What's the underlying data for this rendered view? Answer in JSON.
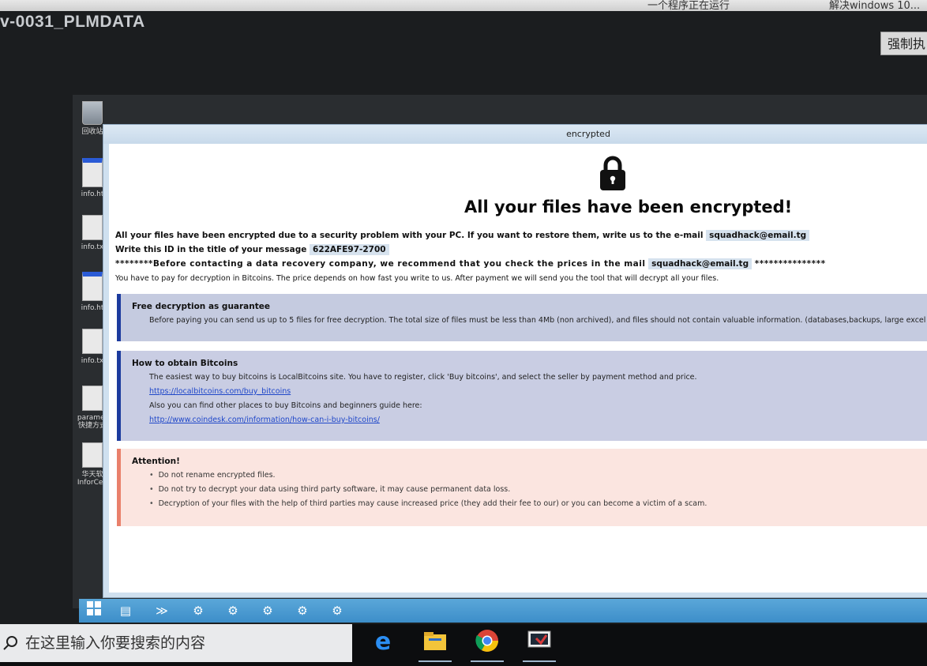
{
  "top_strip": {
    "left_text": "一个程序正在运行",
    "right_text": "解决windows 10..."
  },
  "host_window_title": "v-0031_PLMDATA",
  "top_right_button": "强制执",
  "desktop_icons": [
    {
      "label": "回收站",
      "icon": "recycle-bin-icon"
    },
    {
      "label": "info.ht",
      "icon": "html-file-icon"
    },
    {
      "label": "info.tx",
      "icon": "text-file-icon"
    },
    {
      "label": "info.ht",
      "icon": "html-file-icon"
    },
    {
      "label": "info.tx",
      "icon": "text-file-icon"
    },
    {
      "label": "paramet 快捷方式",
      "icon": "shortcut-file-icon"
    },
    {
      "label": "华天软 InforCen",
      "icon": "shortcut-file-icon"
    }
  ],
  "ransom": {
    "window_title": "encrypted",
    "headline": "All your files have been encrypted!",
    "line1_text": "All your files have been encrypted due to a security problem with your PC. If you want to restore them, write us to the e-mail",
    "email": "squadhack@email.tg",
    "line2_text": "Write this ID in the title of your message",
    "id": "622AFE97-2700",
    "line3_prefix": "********Before contacting a data recovery company, we recommend that you check the prices in the mail",
    "line3_suffix": "***************",
    "line4_text": "You have to pay for decryption in Bitcoins. The price depends on how fast you write to us. After payment we will send you the tool that will decrypt all your files.",
    "free_decryption": {
      "title": "Free decryption as guarantee",
      "text": "Before paying you can send us up to 5 files for free decryption. The total size of files must be less than 4Mb (non archived), and files should not contain valuable information. (databases,backups, large excel sheets, etc"
    },
    "bitcoins": {
      "title": "How to obtain Bitcoins",
      "text1": "The easiest way to buy bitcoins is LocalBitcoins site. You have to register, click 'Buy bitcoins', and select the seller by payment method and price.",
      "link1": "https://localbitcoins.com/buy_bitcoins",
      "text2": "Also you can find other places to buy Bitcoins and beginners guide here:",
      "link2": "http://www.coindesk.com/information/how-can-i-buy-bitcoins/"
    },
    "attention": {
      "title": "Attention!",
      "items": [
        "Do not rename encrypted files.",
        "Do not try to decrypt your data using third party software, it may cause permanent data loss.",
        "Decryption of your files with the help of third parties may cause increased price (they add their fee to our) or you can become a victim of a scam."
      ]
    }
  },
  "host_taskbar": {
    "search_placeholder": "在这里输入你要搜索的内容",
    "apps": [
      "edge-icon",
      "file-explorer-icon",
      "chrome-icon",
      "remote-desktop-icon"
    ]
  },
  "colors": {
    "free_panel_accent": "#1c3b9e",
    "attention_accent": "#e9806b",
    "link": "#1f47c9"
  }
}
